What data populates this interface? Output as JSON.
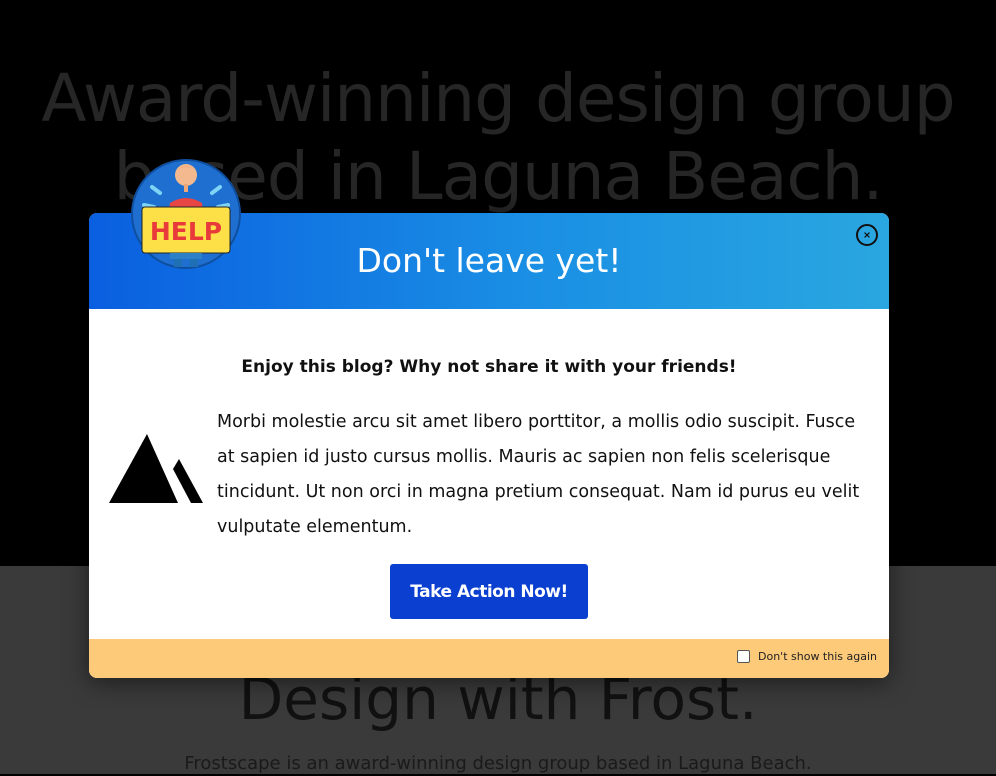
{
  "page": {
    "hero_title_line1": "Award-winning design group",
    "hero_title_line2": "based in Laguna Beach.",
    "section_title": "Design with Frost.",
    "section_text": "Frostscape is an award-winning design group based in Laguna Beach."
  },
  "popup": {
    "title": "Don't leave yet!",
    "subtitle": "Enjoy this blog? Why not share it with your friends!",
    "body": "Morbi molestie arcu sit amet libero porttitor, a mollis odio suscipit. Fusce at sapien id justo cursus mollis. Mauris ac sapien non felis scelerisque tincidunt. Ut non orci in magna pretium consequat. Nam id purus eu velit vulputate elementum.",
    "cta_label": "Take Action Now!",
    "dont_show_label": "Don't show this again",
    "dont_show_checked": false,
    "help_sign_text": "HELP",
    "icons": {
      "close": "close-icon",
      "logo": "mountain-logo-icon",
      "help": "help-sign-icon"
    },
    "colors": {
      "header_gradient_start": "#0a5fe0",
      "header_gradient_end": "#2aa6e0",
      "cta_background": "#0a3fd0",
      "footer_background": "#fdca7a"
    }
  }
}
